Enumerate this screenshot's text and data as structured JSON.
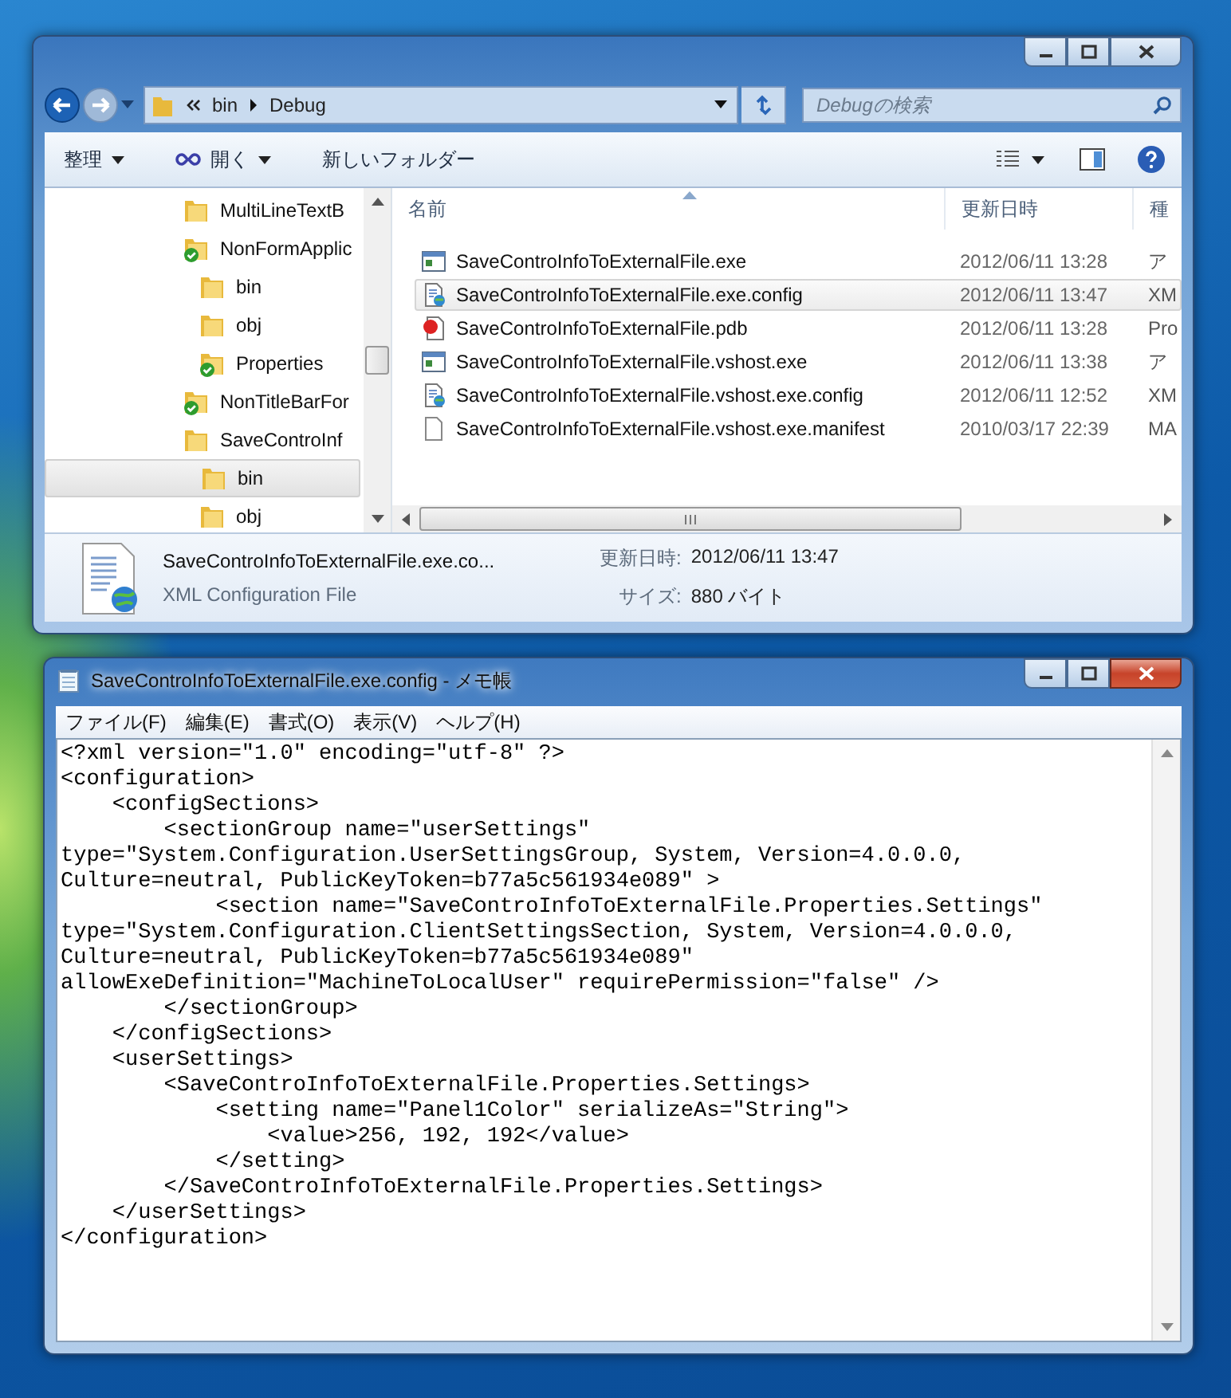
{
  "explorer": {
    "active": false,
    "address": [
      "bin",
      "Debug"
    ],
    "search": {
      "placeholder": "Debugの検索"
    },
    "toolbar": [
      {
        "label": "整理",
        "kind": "menu"
      },
      {
        "label": "開く",
        "kind": "open-menu"
      },
      {
        "label": "新しいフォルダー",
        "kind": "plain"
      }
    ],
    "tree": [
      {
        "label": "MultiLineTextB",
        "kind": "folder",
        "selected": false
      },
      {
        "label": "NonFormApplic",
        "kind": "synced-folder",
        "selected": false,
        "children": [
          {
            "label": "bin",
            "kind": "folder",
            "selected": false
          },
          {
            "label": "obj",
            "kind": "folder",
            "selected": false
          },
          {
            "label": "Properties",
            "kind": "synced-folder",
            "selected": false
          }
        ]
      },
      {
        "label": "NonTitleBarFor",
        "kind": "synced-folder",
        "selected": false
      },
      {
        "label": "SaveControInf",
        "kind": "folder",
        "selected": false,
        "children": [
          {
            "label": "bin",
            "kind": "folder",
            "selected": true
          },
          {
            "label": "obj",
            "kind": "folder",
            "selected": false
          }
        ]
      }
    ],
    "columns": [
      "名前",
      "更新日時",
      "種"
    ],
    "files": [
      {
        "name": "SaveControInfoToExternalFile.exe",
        "date": "2012/06/11 13:28",
        "type": "ア",
        "kind": "exe",
        "selected": false
      },
      {
        "name": "SaveControInfoToExternalFile.exe.config",
        "date": "2012/06/11 13:47",
        "type": "XM",
        "kind": "config",
        "selected": true
      },
      {
        "name": "SaveControInfoToExternalFile.pdb",
        "date": "2012/06/11 13:28",
        "type": "Pro",
        "kind": "pdb",
        "selected": false
      },
      {
        "name": "SaveControInfoToExternalFile.vshost.exe",
        "date": "2012/06/11 13:38",
        "type": "ア",
        "kind": "exe",
        "selected": false
      },
      {
        "name": "SaveControInfoToExternalFile.vshost.exe.config",
        "date": "2012/06/11 12:52",
        "type": "XM",
        "kind": "config",
        "selected": false
      },
      {
        "name": "SaveControInfoToExternalFile.vshost.exe.manifest",
        "date": "2010/03/17 22:39",
        "type": "MA",
        "kind": "manifest",
        "selected": false
      }
    ],
    "details": {
      "name": "SaveControInfoToExternalFile.exe.co...",
      "type": "XML Configuration File",
      "date_label": "更新日時:",
      "date": "2012/06/11 13:47",
      "size_label": "サイズ:",
      "size": "880 バイト"
    }
  },
  "notepad": {
    "active": true,
    "title": "SaveControInfoToExternalFile.exe.config - メモ帳",
    "menu": [
      "ファイル(F)",
      "編集(E)",
      "書式(O)",
      "表示(V)",
      "ヘルプ(H)"
    ],
    "lines": [
      "<?xml version=\"1.0\" encoding=\"utf-8\" ?>",
      "<configuration>",
      "    <configSections>",
      "        <sectionGroup name=\"userSettings\"",
      "type=\"System.Configuration.UserSettingsGroup, System, Version=4.0.0.0,",
      "Culture=neutral, PublicKeyToken=b77a5c561934e089\" >",
      "            <section name=\"SaveControInfoToExternalFile.Properties.Settings\"",
      "type=\"System.Configuration.ClientSettingsSection, System, Version=4.0.0.0,",
      "Culture=neutral, PublicKeyToken=b77a5c561934e089\"",
      "allowExeDefinition=\"MachineToLocalUser\" requirePermission=\"false\" />",
      "        </sectionGroup>",
      "    </configSections>",
      "    <userSettings>",
      "        <SaveControInfoToExternalFile.Properties.Settings>",
      "            <setting name=\"Panel1Color\" serializeAs=\"String\">",
      "                <value>256, 192, 192</value>",
      "            </setting>",
      "        </SaveControInfoToExternalFile.Properties.Settings>",
      "    </userSettings>",
      "</configuration>"
    ]
  }
}
